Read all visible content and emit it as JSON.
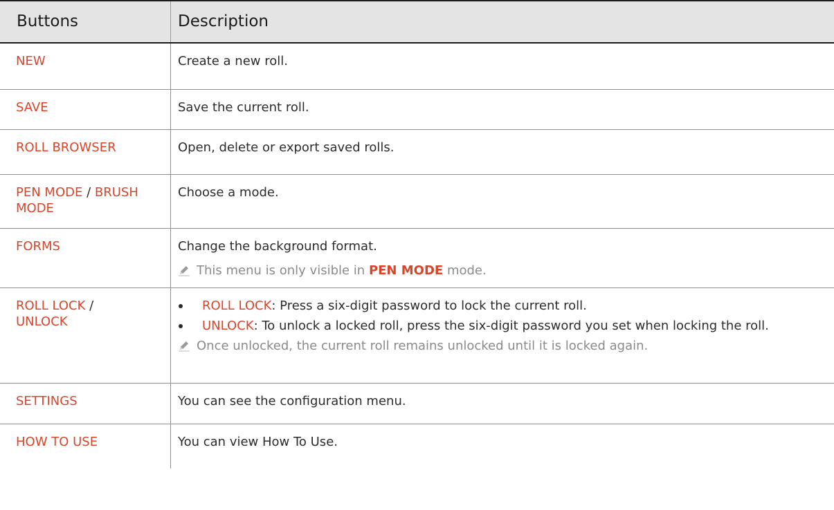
{
  "header": {
    "col1": "Buttons",
    "col2": "Description"
  },
  "rows": [
    {
      "button": "NEW",
      "desc": "Create a new roll."
    },
    {
      "button": "SAVE",
      "desc": "Save the current roll."
    },
    {
      "button": "ROLL BROWSER",
      "desc": "Open, delete or export saved rolls."
    },
    {
      "button_a": "PEN MODE",
      "sep": " / ",
      "button_b": "BRUSH MODE",
      "desc": "Choose a mode."
    },
    {
      "button": "FORMS",
      "desc": "Change the background format.",
      "note_pre": "This menu is only visible in ",
      "note_hl": "PEN MODE",
      "note_post": " mode."
    },
    {
      "button_a": "ROLL LOCK",
      "sep": " / ",
      "button_b": "UNLOCK",
      "bullet1_hl": "ROLL LOCK",
      "bullet1_text": ": Press a six-digit password to lock the current roll.",
      "bullet2_hl": "UNLOCK",
      "bullet2_text": ": To unlock a locked roll, press the six-digit password you set when locking the roll.",
      "note": "Once unlocked, the current roll remains unlocked until it is locked again."
    },
    {
      "button": "SETTINGS",
      "desc": "You can see the configuration menu."
    },
    {
      "button": "HOW TO USE",
      "desc": "You can view How To Use."
    }
  ],
  "colors": {
    "accent": "#d8452a",
    "header_bg": "#e4e4e4",
    "note_text": "#8a8a8a"
  },
  "icons": {
    "note": "pencil-note-icon"
  }
}
